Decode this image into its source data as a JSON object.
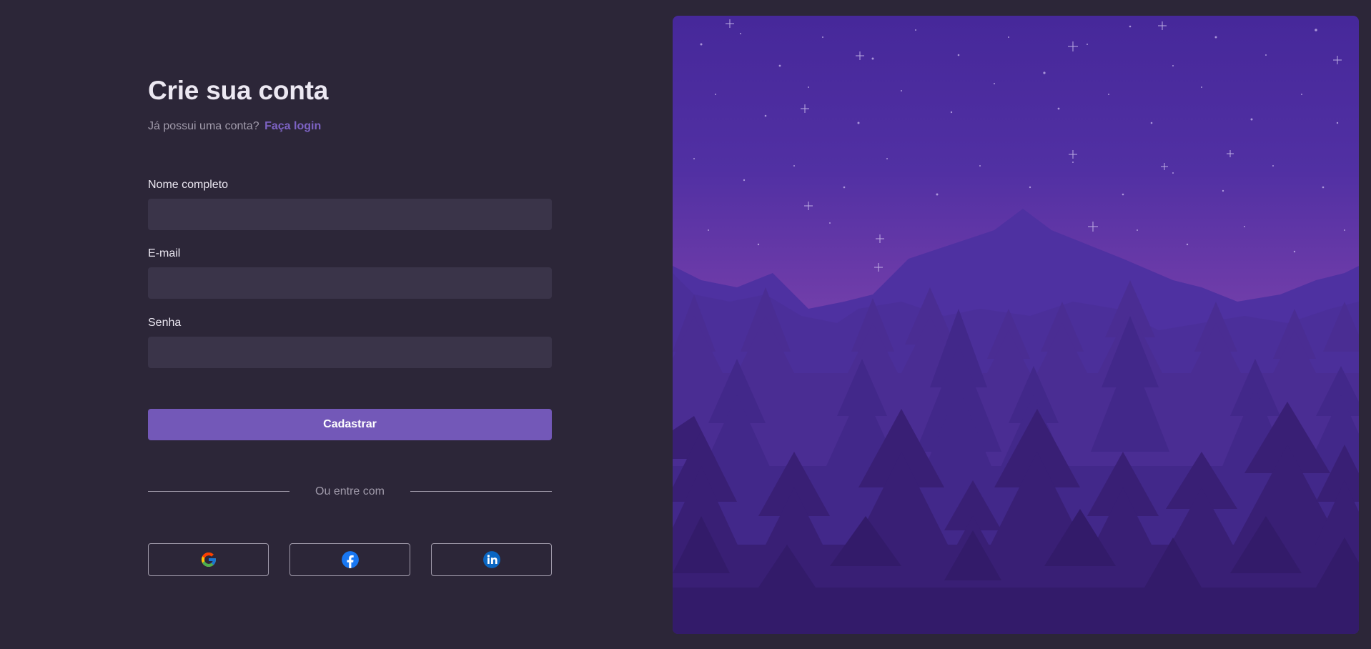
{
  "form": {
    "title": "Crie sua conta",
    "have_account_text": "Já possui uma conta?",
    "login_link": "Faça login",
    "fields": [
      {
        "label": "Nome completo",
        "value": "",
        "placeholder": ""
      },
      {
        "label": "E-mail",
        "value": "",
        "placeholder": ""
      },
      {
        "label": "Senha",
        "value": "",
        "placeholder": ""
      }
    ],
    "submit_label": "Cadastrar",
    "divider_text": "Ou entre com",
    "social_buttons": [
      {
        "icon": "google-icon"
      },
      {
        "icon": "facebook-icon"
      },
      {
        "icon": "linkedin-icon"
      }
    ]
  },
  "colors": {
    "background": "#2c2638",
    "input_bg": "#3a3449",
    "accent": "#7358b8",
    "link": "#7d63c4",
    "muted_text": "#a19bab",
    "text": "#ece8f2"
  },
  "illustration": {
    "subject": "night-forest-mountains"
  }
}
